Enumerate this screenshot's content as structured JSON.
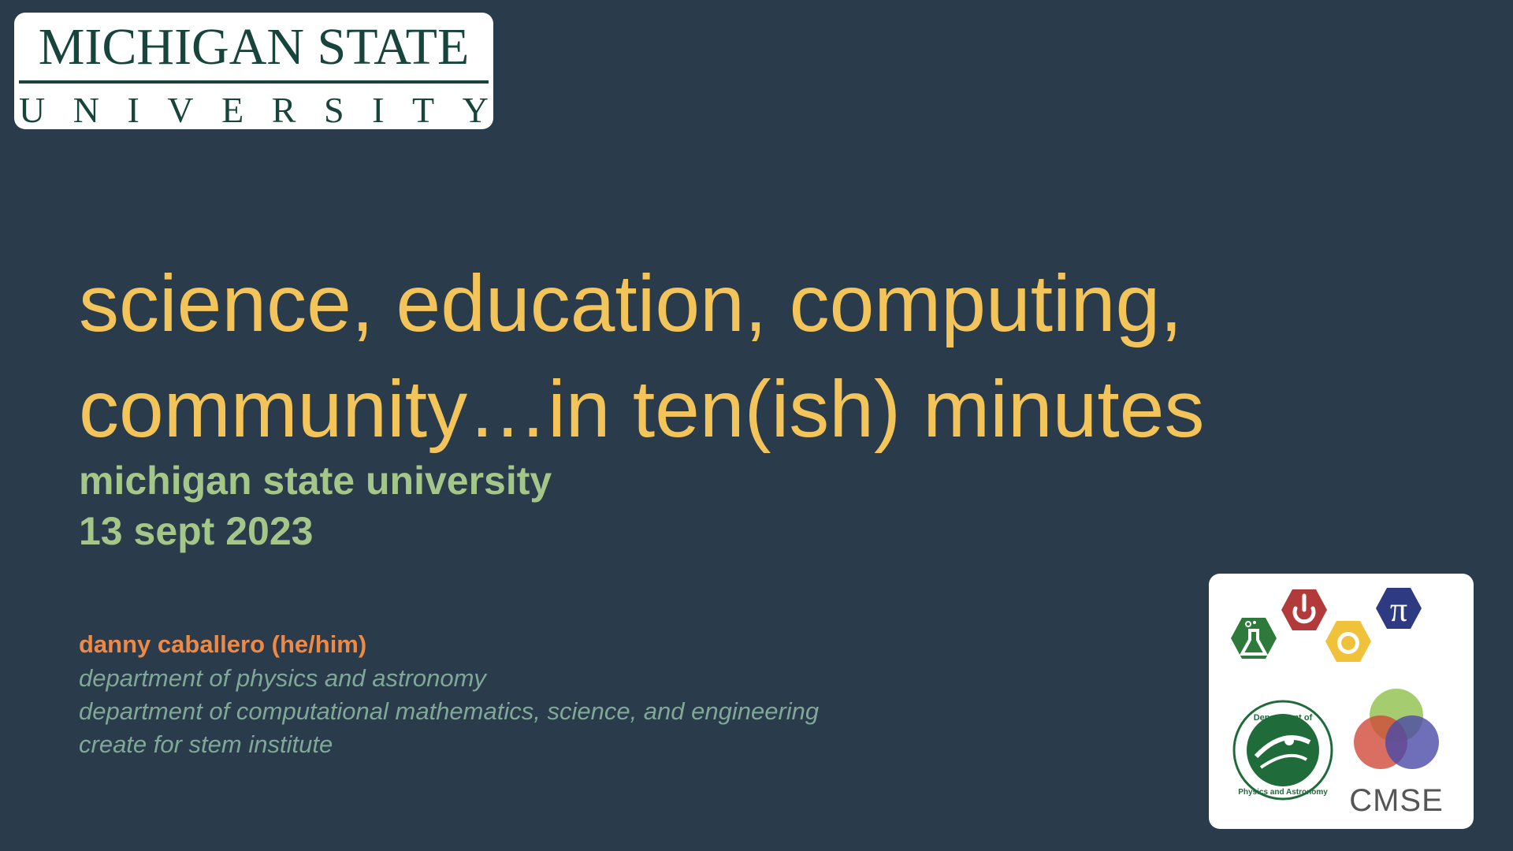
{
  "logo": {
    "line1": "MICHIGAN STATE",
    "line2_letters": [
      "U",
      "N",
      "I",
      "V",
      "E",
      "R",
      "S",
      "I",
      "T",
      "Y"
    ],
    "color": "#18453b"
  },
  "title": {
    "line1": "science, education, computing,",
    "line2": "community…in ten(ish) minutes"
  },
  "subtitle": {
    "line1": "michigan state university",
    "line2": "13 sept 2023"
  },
  "author": "danny caballero (he/him)",
  "affiliations": [
    "department of physics and astronomy",
    "department of computational mathematics, science, and engineering",
    "create for stem institute"
  ],
  "logos": {
    "dept_seal_top": "Department of",
    "dept_seal_bottom": "Physics and Astronomy",
    "cmse": "CMSE",
    "pi_symbol": "π"
  },
  "colors": {
    "background": "#2a3b4c",
    "title": "#f2c45a",
    "subtitle": "#a4c689",
    "author": "#ee8a45",
    "affiliation": "#7fa996"
  }
}
